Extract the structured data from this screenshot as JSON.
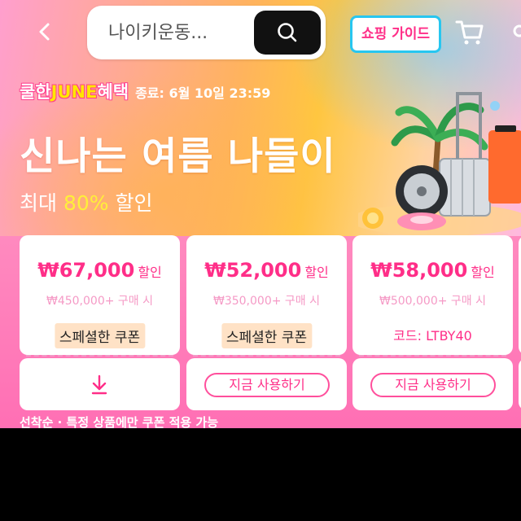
{
  "top_bar": {
    "search_placeholder": "나이키운동...",
    "guide_label": "쇼핑 가이드"
  },
  "hero": {
    "promo_prefix": "쿨한",
    "promo_june": "JUNE",
    "promo_suffix": "혜택",
    "promo_end": "종료: 6월 10일 23:59",
    "title": "신나는 여름 나들이",
    "sub_prefix": "최대 ",
    "sub_pct": "80%",
    "sub_suffix": " 할인"
  },
  "coupons": [
    {
      "amount": "₩67,000",
      "unit": "할인",
      "min": "₩450,000+ 구매 시",
      "tag": "스페셜한 쿠폰"
    },
    {
      "amount": "₩52,000",
      "unit": "할인",
      "min": "₩350,000+ 구매 시",
      "tag": "스페셜한 쿠폰",
      "use_label": "지금 사용하기"
    },
    {
      "amount": "₩58,000",
      "unit": "할인",
      "min": "₩500,000+ 구매 시",
      "code": "코드: LTBY40",
      "use_label": "지금 사용하기"
    }
  ],
  "notice": "선착순 · 특정 상품에만 쿠폰 적용 가능",
  "colors": {
    "accent_pink": "#ff2e88",
    "guide_border": "#27c6f0",
    "highlight_yellow": "#ffef3a"
  },
  "icons": [
    "back-arrow-icon",
    "search-icon",
    "cart-icon",
    "download-arrow-icon"
  ]
}
